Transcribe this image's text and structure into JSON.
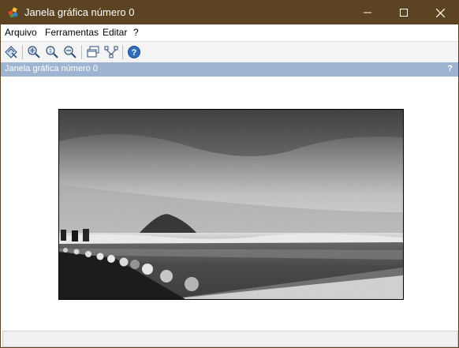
{
  "window": {
    "title": "Janela gráfica número 0",
    "icon": "colorful-pinwheel-icon",
    "controls": [
      "minimize-icon",
      "maximize-icon",
      "close-icon"
    ]
  },
  "menu": {
    "items": [
      "Arquivo",
      "Ferramentas",
      "Editar",
      "?"
    ]
  },
  "toolbar": {
    "buttons": [
      "select-tool-icon",
      "zoom-in-icon",
      "zoom-original-icon",
      "zoom-out-icon",
      "windows-icon",
      "network-icon",
      "help-icon"
    ]
  },
  "view": {
    "title": "Janela gráfica número 0",
    "help": "?"
  },
  "colors": {
    "titlebar": "#5c4322",
    "view_header": "#9db4d2"
  },
  "image": {
    "description": "grayscale photo of a beach promenade with an island and stormy sky"
  }
}
